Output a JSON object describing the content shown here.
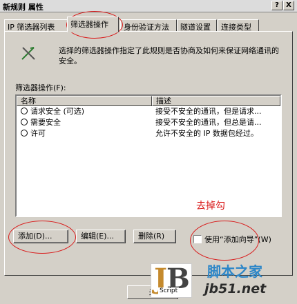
{
  "window": {
    "title": "新规则 属性",
    "help_btn": "?",
    "close_btn": "X"
  },
  "tabs": [
    {
      "label": "IP 筛选器列表"
    },
    {
      "label": "筛选器操作"
    },
    {
      "label": "身份验证方法"
    },
    {
      "label": "隧道设置"
    },
    {
      "label": "连接类型"
    }
  ],
  "description": "选择的筛选器操作指定了此规则是否协商及如何来保证网络通讯的安全。",
  "list": {
    "label": "筛选器操作(F):",
    "columns": [
      "名称",
      "描述"
    ],
    "rows": [
      {
        "name": "请求安全 (可选)",
        "desc": "接受不安全的通讯，但是请求..."
      },
      {
        "name": "需要安全",
        "desc": "接受不安全的通讯，但总是请..."
      },
      {
        "name": "许可",
        "desc": "允许不安全的 IP 数据包经过。"
      }
    ]
  },
  "buttons": {
    "add": "添加(D)...",
    "edit": "编辑(E)...",
    "remove": "删除(R)",
    "use_wizard": "使用“添加向导”(W)",
    "close": "关"
  },
  "annotation": {
    "text": "去掉勾",
    "color": "#d91a1a"
  },
  "watermark": {
    "site_name": "脚本之家",
    "url": "jb51.net",
    "logo_letters": "JB",
    "logo_script": "Script"
  }
}
